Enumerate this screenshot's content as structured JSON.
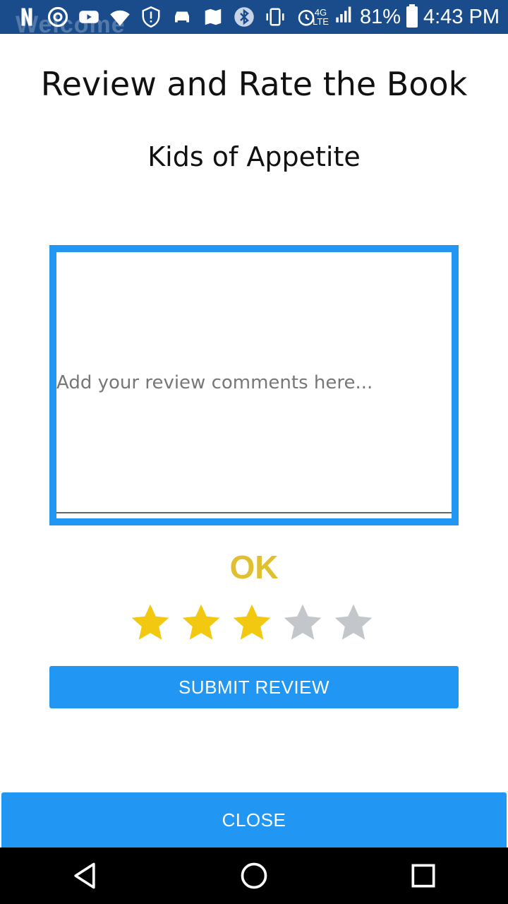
{
  "status_bar": {
    "background": "Welcome",
    "battery": "81%",
    "time": "4:43 PM",
    "icons": [
      "netflix-icon",
      "chrome-icon",
      "youtube-icon",
      "wifi-icon",
      "alert-icon",
      "car-icon",
      "maps-icon",
      "bluetooth-icon",
      "vibrate-icon",
      "alarm-icon",
      "4g-lte-icon",
      "signal-icon",
      "battery-icon"
    ]
  },
  "dialog": {
    "title": "Review and Rate the Book",
    "book_title": "Kids of Appetite",
    "review_placeholder": "Add your review comments here...",
    "review_value": "",
    "rating_label": "OK",
    "rating": 3,
    "max_rating": 5,
    "submit_label": "SUBMIT REVIEW",
    "close_label": "CLOSE"
  },
  "colors": {
    "accent": "#2196f3",
    "star_filled": "#f2c811",
    "star_empty": "#c3c7cc",
    "rating_label": "#e0c030",
    "status_bar": "#1a4c8c"
  },
  "nav_bar": {
    "buttons": [
      "back-icon",
      "home-icon",
      "recents-icon"
    ]
  }
}
